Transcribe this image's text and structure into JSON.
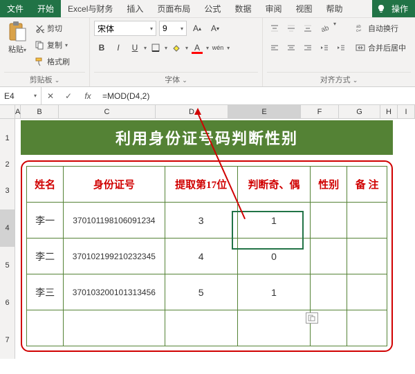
{
  "menu": {
    "file": "文件",
    "home": "开始",
    "excel_fin": "Excel与财务",
    "insert": "插入",
    "layout": "页面布局",
    "formula": "公式",
    "data": "数据",
    "review": "审阅",
    "view": "视图",
    "help": "帮助",
    "tell_me": "操作"
  },
  "ribbon": {
    "clipboard_label": "剪贴板",
    "paste": "粘贴",
    "cut": "剪切",
    "copy": "复制",
    "format_painter": "格式刷",
    "font_label": "字体",
    "font_name": "宋体",
    "font_size": "9",
    "bold": "B",
    "italic": "I",
    "underline": "U",
    "align_label": "对齐方式",
    "wrap_text": "自动换行",
    "merge_cells": "合并后居中"
  },
  "namebox": "E4",
  "formula": "=MOD(D4,2)",
  "columns": [
    "A",
    "B",
    "C",
    "D",
    "E",
    "F",
    "G",
    "H",
    "I"
  ],
  "rows": [
    "",
    "1",
    "2",
    "",
    "3",
    "",
    "4",
    "5",
    "6",
    "",
    "7"
  ],
  "banner": "利用身份证号码判断性别",
  "table": {
    "headers": [
      "姓名",
      "身份证号",
      "提取第17位",
      "判断奇、偶",
      "性别",
      "备 注"
    ],
    "rows": [
      {
        "name": "李一",
        "id": "370101198106091234",
        "d17": "3",
        "odd": "1",
        "sex": "",
        "note": ""
      },
      {
        "name": "李二",
        "id": "370102199210232345",
        "d17": "4",
        "odd": "0",
        "sex": "",
        "note": ""
      },
      {
        "name": "李三",
        "id": "370103200101313456",
        "d17": "5",
        "odd": "1",
        "sex": "",
        "note": ""
      },
      {
        "name": "",
        "id": "",
        "d17": "",
        "odd": "",
        "sex": "",
        "note": ""
      }
    ]
  }
}
